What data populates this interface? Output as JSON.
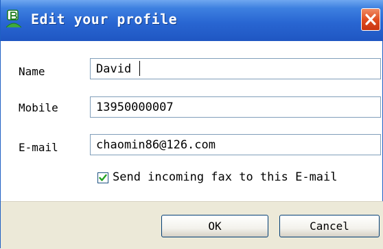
{
  "window": {
    "title": "Edit your profile",
    "icon": "app-b-icon",
    "close_icon": "close-icon"
  },
  "form": {
    "name_label": "Name",
    "name_value": "David",
    "mobile_label": "Mobile",
    "mobile_value": "13950000007",
    "email_label": "E-mail",
    "email_value": "chaomin86@126.com",
    "forward_label": "Send incoming fax to this E-mail",
    "forward_checked": true
  },
  "buttons": {
    "ok_label": "OK",
    "cancel_label": "Cancel"
  },
  "colors": {
    "titlebar": "#2966d2",
    "close": "#e04e22",
    "footer": "#ece9d8",
    "check": "#21a121"
  }
}
